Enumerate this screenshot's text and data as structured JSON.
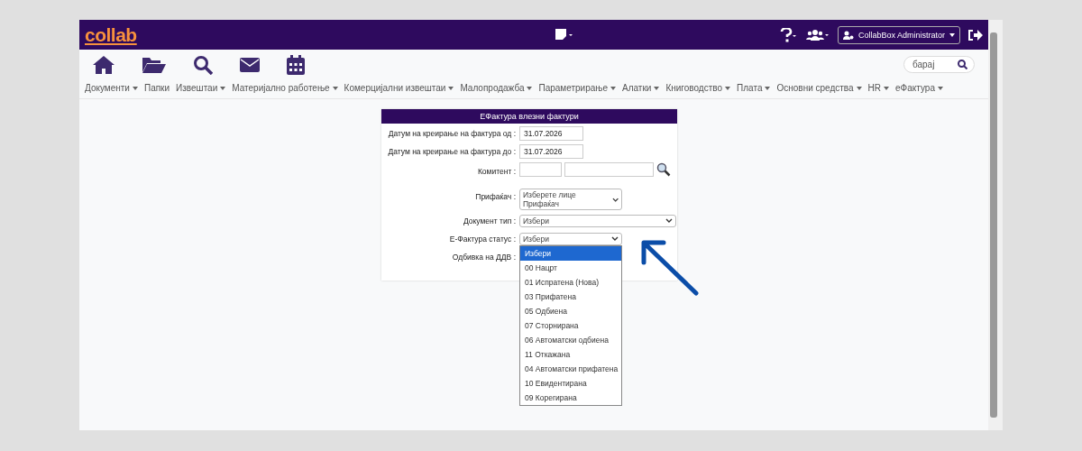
{
  "header": {
    "logo": "collab",
    "user_button": "CollabBox Administrator"
  },
  "search": {
    "placeholder": "барај"
  },
  "menu": [
    {
      "label": "Документи",
      "has_menu": true
    },
    {
      "label": "Папки",
      "has_menu": false
    },
    {
      "label": "Извештаи",
      "has_menu": true
    },
    {
      "label": "Материјално работење",
      "has_menu": true
    },
    {
      "label": "Комерцијални извештаи",
      "has_menu": true
    },
    {
      "label": "Малопродажба",
      "has_menu": true
    },
    {
      "label": "Параметрирање",
      "has_menu": true
    },
    {
      "label": "Алатки",
      "has_menu": true
    },
    {
      "label": "Книговодство",
      "has_menu": true
    },
    {
      "label": "Плата",
      "has_menu": true
    },
    {
      "label": "Основни средства",
      "has_menu": true
    },
    {
      "label": "HR",
      "has_menu": true
    },
    {
      "label": "еФактура",
      "has_menu": true
    }
  ],
  "form": {
    "title": "ЕФактура влезни фактури",
    "fields": [
      {
        "kind": "date",
        "label": "Датум на креирање на фактура од :",
        "value": "31.07.2026"
      },
      {
        "kind": "date",
        "label": "Датум на креирање на фактура до :",
        "value": "31.07.2026"
      },
      {
        "kind": "lookup",
        "label": "Комитент :"
      },
      {
        "kind": "select",
        "label": "Прифаќач :",
        "value": "Изберете лице Прифаќач"
      },
      {
        "kind": "wideselect",
        "label": "Документ тип :",
        "value": "Избери"
      },
      {
        "kind": "openselect",
        "label": "Е-Фактура статус :",
        "value": "Избери"
      },
      {
        "kind": "label",
        "label": "Одбивка на ДДВ :"
      }
    ]
  },
  "dropdown_options": [
    {
      "label": "Избери",
      "selected": true
    },
    {
      "label": "00 Нацрт",
      "selected": false
    },
    {
      "label": "01 Испратена (Нова)",
      "selected": false
    },
    {
      "label": "03 Прифатена",
      "selected": false
    },
    {
      "label": "05 Одбиена",
      "selected": false
    },
    {
      "label": "07 Сторнирана",
      "selected": false
    },
    {
      "label": "06 Автоматски одбиена",
      "selected": false
    },
    {
      "label": "11 Откажана",
      "selected": false
    },
    {
      "label": "04 Автоматски прифатена",
      "selected": false
    },
    {
      "label": "10 Евидентирана",
      "selected": false
    },
    {
      "label": "09 Корегирана",
      "selected": false
    }
  ]
}
